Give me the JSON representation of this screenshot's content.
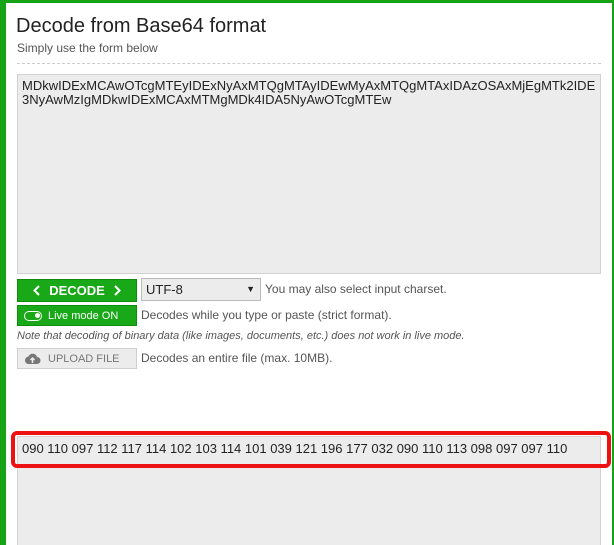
{
  "page": {
    "title": "Decode from Base64 format",
    "subtitle": "Simply use the form below"
  },
  "input": {
    "value": "MDkwIDExMCAwOTcgMTEyIDExNyAxMTQgMTAyIDEwMyAxMTQgMTAxIDAzOSAxMjEgMTk2IDE3NyAwMzIgMDkwIDExMCAxMTMgMDk4IDA5NyAwOTcgMTEw"
  },
  "controls": {
    "decode_label": "DECODE",
    "charset_selected": "UTF-8",
    "charset_note": "You may also select input charset.",
    "live_mode_label": "Live mode ON",
    "live_mode_note": "Decodes while you type or paste (strict format).",
    "binary_note": "Note that decoding of binary data (like images, documents, etc.) does not work in live mode.",
    "upload_label": "UPLOAD FILE",
    "upload_note": "Decodes an entire file (max. 10MB)."
  },
  "output": {
    "value": "090 110 097 112 117 114 102 103 114 101 039 121 196 177 032 090 110 113 098 097 097 110"
  },
  "colors": {
    "accent_green": "#18a818",
    "highlight_red": "#ee1111"
  },
  "icons": {
    "decode_left": "chevron-left-icon",
    "decode_right": "chevron-right-icon",
    "upload": "cloud-upload-icon",
    "toggle": "toggle-switch-icon"
  }
}
